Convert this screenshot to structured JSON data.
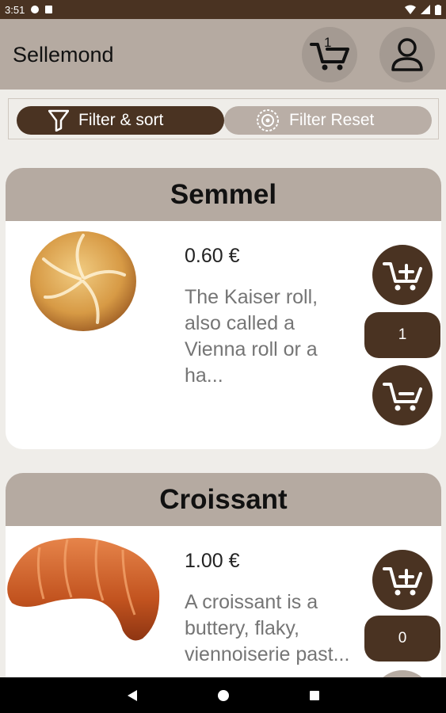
{
  "status_bar": {
    "time": "3:51"
  },
  "app_bar": {
    "title": "Sellemond",
    "cart_count": "1",
    "cart_icon": "cart-icon",
    "user_icon": "user-icon"
  },
  "filters": {
    "sort_label": "Filter & sort",
    "reset_label": "Filter Reset"
  },
  "products": [
    {
      "name": "Semmel",
      "price": "0.60 €",
      "description": "The Kaiser roll, also called a Vienna roll or a ha...",
      "quantity": "1"
    },
    {
      "name": "Croissant",
      "price": "1.00 €",
      "description": "A croissant is a buttery, flaky, viennoiserie past...",
      "quantity": "0"
    }
  ],
  "colors": {
    "primary": "#4a3322",
    "header_bg": "#b5aaa1",
    "background": "#efede9"
  }
}
